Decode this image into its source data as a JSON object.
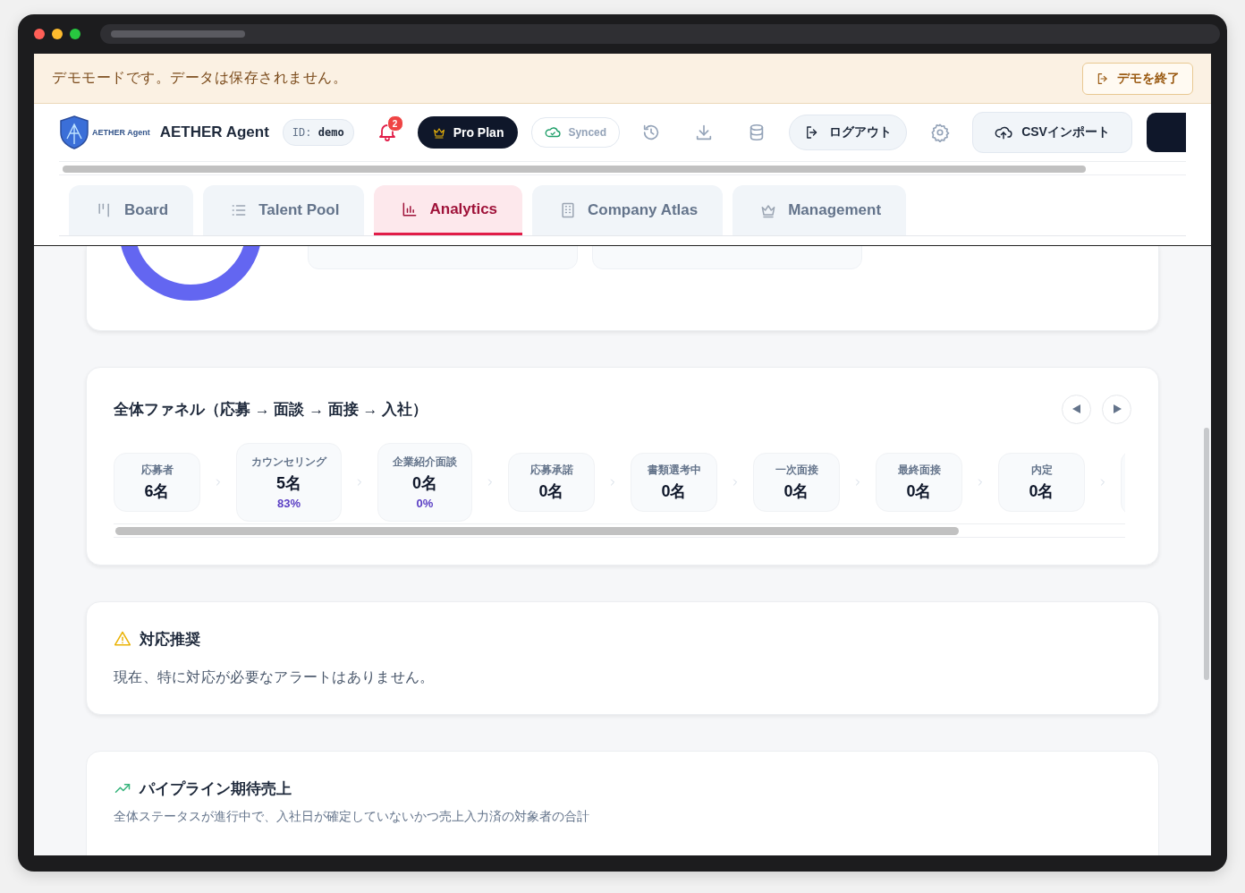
{
  "demo_banner": {
    "message": "デモモードです。データは保存されません。",
    "exit_button": "デモを終了"
  },
  "header": {
    "logo_text": "AETHER Agent",
    "app_name": "AETHER Agent",
    "user_id": "ID: **demo**",
    "notification_count": "2",
    "plan_button": "Pro Plan",
    "sync_status": "Synced",
    "logout_button": "ログアウト",
    "import_button": "CSVインポート"
  },
  "tabs": [
    {
      "label": "Board",
      "selected": false
    },
    {
      "label": "Talent Pool",
      "selected": false
    },
    {
      "label": "Analytics",
      "selected": true
    },
    {
      "label": "Company Atlas",
      "selected": false
    },
    {
      "label": "Management",
      "selected": false
    }
  ],
  "funnel": {
    "title": "全体ファネル（応募 → 面談 → 面接 → 入社）",
    "stages": [
      {
        "label": "応募者",
        "count": "6名"
      },
      {
        "label": "カウンセリング",
        "count": "5名",
        "rate": "83%"
      },
      {
        "label": "企業紹介面談",
        "count": "0名",
        "rate": "0%"
      },
      {
        "label": "応募承諾",
        "count": "0名"
      },
      {
        "label": "書類選考中",
        "count": "0名"
      },
      {
        "label": "一次面接",
        "count": "0名"
      },
      {
        "label": "最終面接",
        "count": "0名"
      },
      {
        "label": "内定",
        "count": "0名"
      }
    ]
  },
  "alerts": {
    "title": "対応推奨",
    "message": "現在、特に対応が必要なアラートはありません。"
  },
  "pipeline": {
    "title": "パイプライン期待売上",
    "description": "全体ステータスが進行中で、入社日が確定していないかつ売上入力済の対象者の合計"
  }
}
